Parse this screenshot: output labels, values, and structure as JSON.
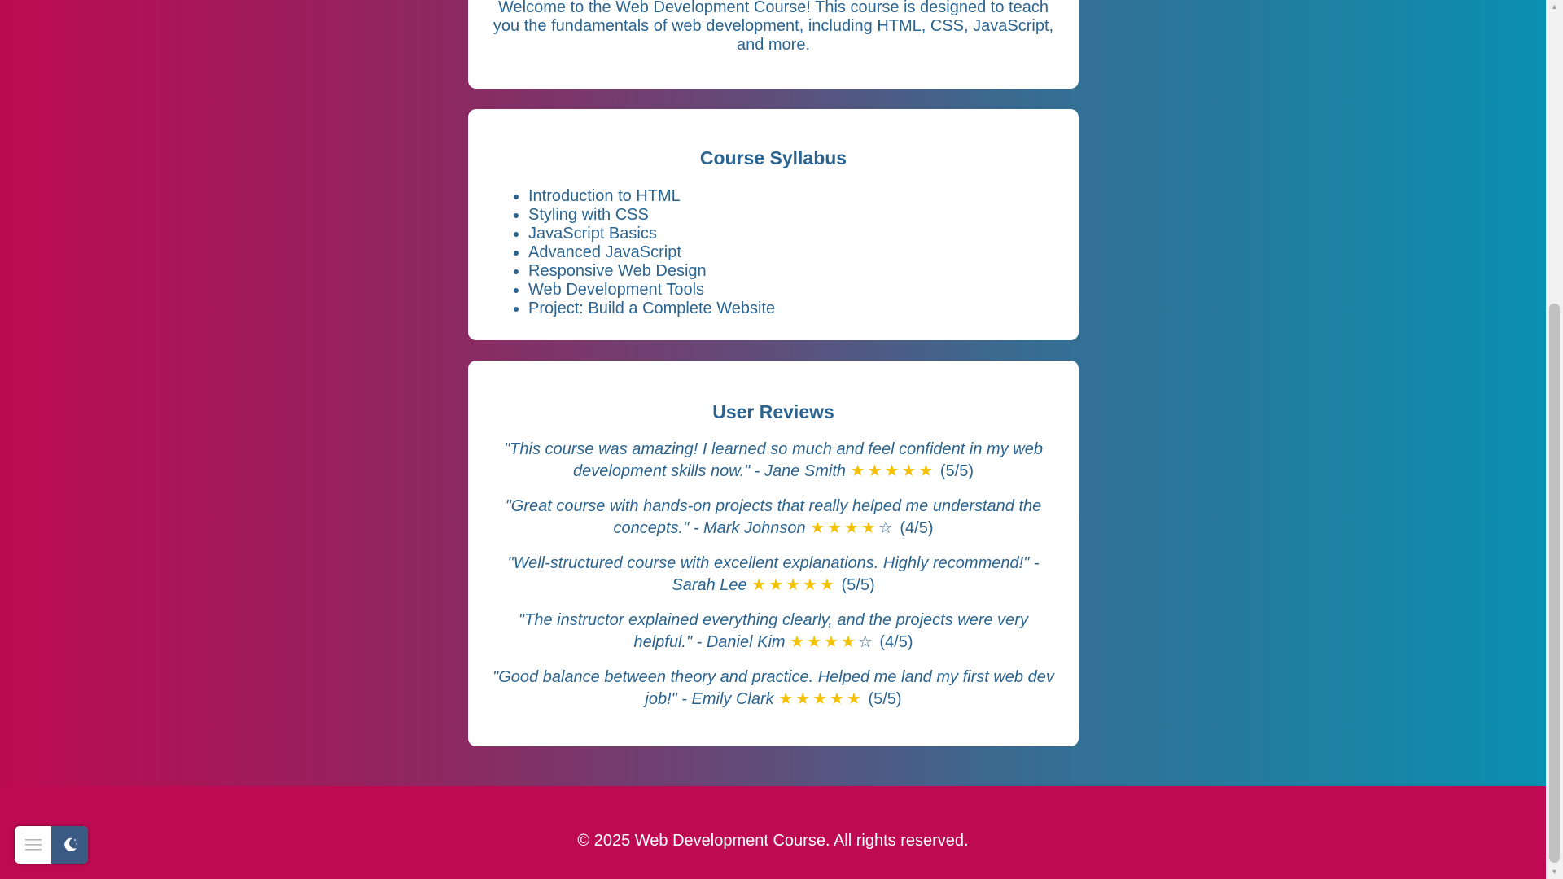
{
  "intro": {
    "text": "Welcome to the Web Development Course! This course is designed to teach you the fundamentals of web development, including HTML, CSS, JavaScript, and more."
  },
  "syllabus": {
    "title": "Course Syllabus",
    "items": [
      "Introduction to HTML",
      "Styling with CSS",
      "JavaScript Basics",
      "Advanced JavaScript",
      "Responsive Web Design",
      "Web Development Tools",
      "Project: Build a Complete Website"
    ]
  },
  "reviews": {
    "title": "User Reviews",
    "items": [
      {
        "text": "\"This course was amazing! I learned so much and feel confident in my web development skills now.\" - Jane Smith",
        "rating": 5,
        "rating_label": "(5/5)"
      },
      {
        "text": "\"Great course with hands-on projects that really helped me understand the concepts.\" - Mark Johnson",
        "rating": 4,
        "rating_label": "(4/5)"
      },
      {
        "text": "\"Well-structured course with excellent explanations. Highly recommend!\" - Sarah Lee",
        "rating": 5,
        "rating_label": "(5/5)"
      },
      {
        "text": "\"The instructor explained everything clearly, and the projects were very helpful.\" - Daniel Kim",
        "rating": 4,
        "rating_label": "(4/5)"
      },
      {
        "text": "\"Good balance between theory and practice. Helped me land my first web dev job!\" - Emily Clark",
        "rating": 5,
        "rating_label": "(5/5)"
      }
    ]
  },
  "footer": {
    "text": "© 2025 Web Development Course. All rights reserved."
  },
  "theme_toggle": {
    "left_icon": "menu-icon",
    "right_icon": "moon-icon"
  },
  "colors": {
    "accent_text": "#2b6490",
    "star": "#f2c100",
    "footer_bg": "#bd0a52"
  }
}
